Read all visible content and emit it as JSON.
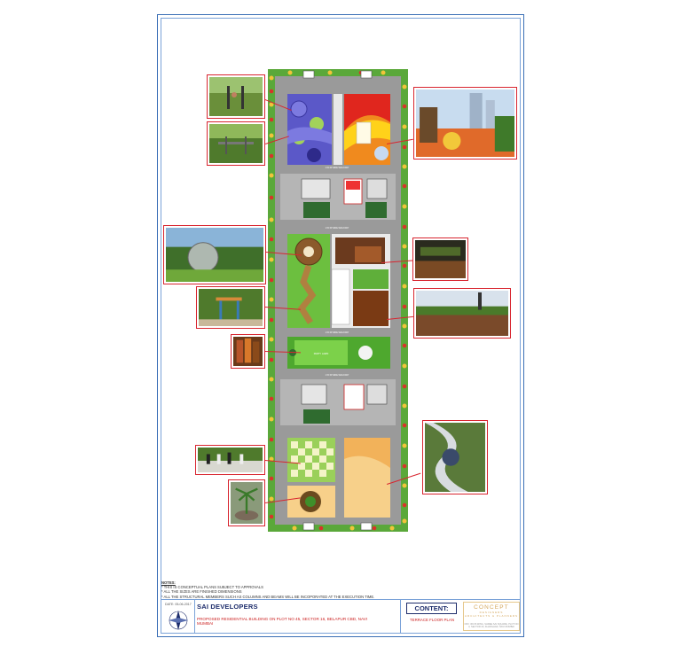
{
  "notes": {
    "title": "NOTES:",
    "lines": [
      "* THIS IS CONCEPTUAL PLANS SUBJECT TO APPROVALS",
      "* ALL THE SIZES ARE FINISHED DIMENSIONS",
      "* ALL THE STRUCTURAL MEMBERS SUCH AS COLUMNS AND BEAMS WILL BE INCOPORATED AT THE EXECUTION TIME."
    ]
  },
  "title_block": {
    "date": "DATE: 05-06-2017",
    "client": "SAI DEVELOPERS",
    "project": "PROPOSED RESIDENTIAL BUILDING ON PLOT NO 45, SECTOR 16, BELAPUR CBD, NAVI MUMBAI",
    "content_label": "CONTENT:",
    "sheet_title": "TERRACE FLOOR PLAN",
    "firm_name": "CONCEPT",
    "firm_sub": "DESIGNERS",
    "firm_tag": "ARCHITECTS & PLANNERS",
    "firm_address": "OFF: 304 B-WING, SHREE SAI SQUARE, PLOT NO 3, SECTOR 20, KHARGHAR, NAVI MUMBAI"
  },
  "plan_labels": {
    "walkway": "1.50 M WIDE WALKWAY",
    "party_lawn": "PARTY LAWN",
    "sculpture": "SCULPTURE PATHWAY"
  },
  "photos": [
    {
      "name": "outdoor-gym-photo-1",
      "subject": "people using outdoor gym equipment"
    },
    {
      "name": "outdoor-gym-photo-2",
      "subject": "outdoor gym equipment on lawn"
    },
    {
      "name": "kids-play-area-photo",
      "subject": "colourful kids play area with towers"
    },
    {
      "name": "sphere-pavilion-photo",
      "subject": "glass sphere pavilion in garden"
    },
    {
      "name": "deck-seating-photo",
      "subject": "wooden deck seating with lights"
    },
    {
      "name": "kids-climbing-photo",
      "subject": "children on play structure"
    },
    {
      "name": "terrace-deck-photo",
      "subject": "terrace wooden deck with planters"
    },
    {
      "name": "vertical-garden-photo",
      "subject": "vertical green wall"
    },
    {
      "name": "chess-board-photo",
      "subject": "giant outdoor chess board"
    },
    {
      "name": "pebble-pathway-photo",
      "subject": "mosaic pebble swirl pathway"
    },
    {
      "name": "palm-planter-photo",
      "subject": "palm tree in round planter"
    }
  ]
}
